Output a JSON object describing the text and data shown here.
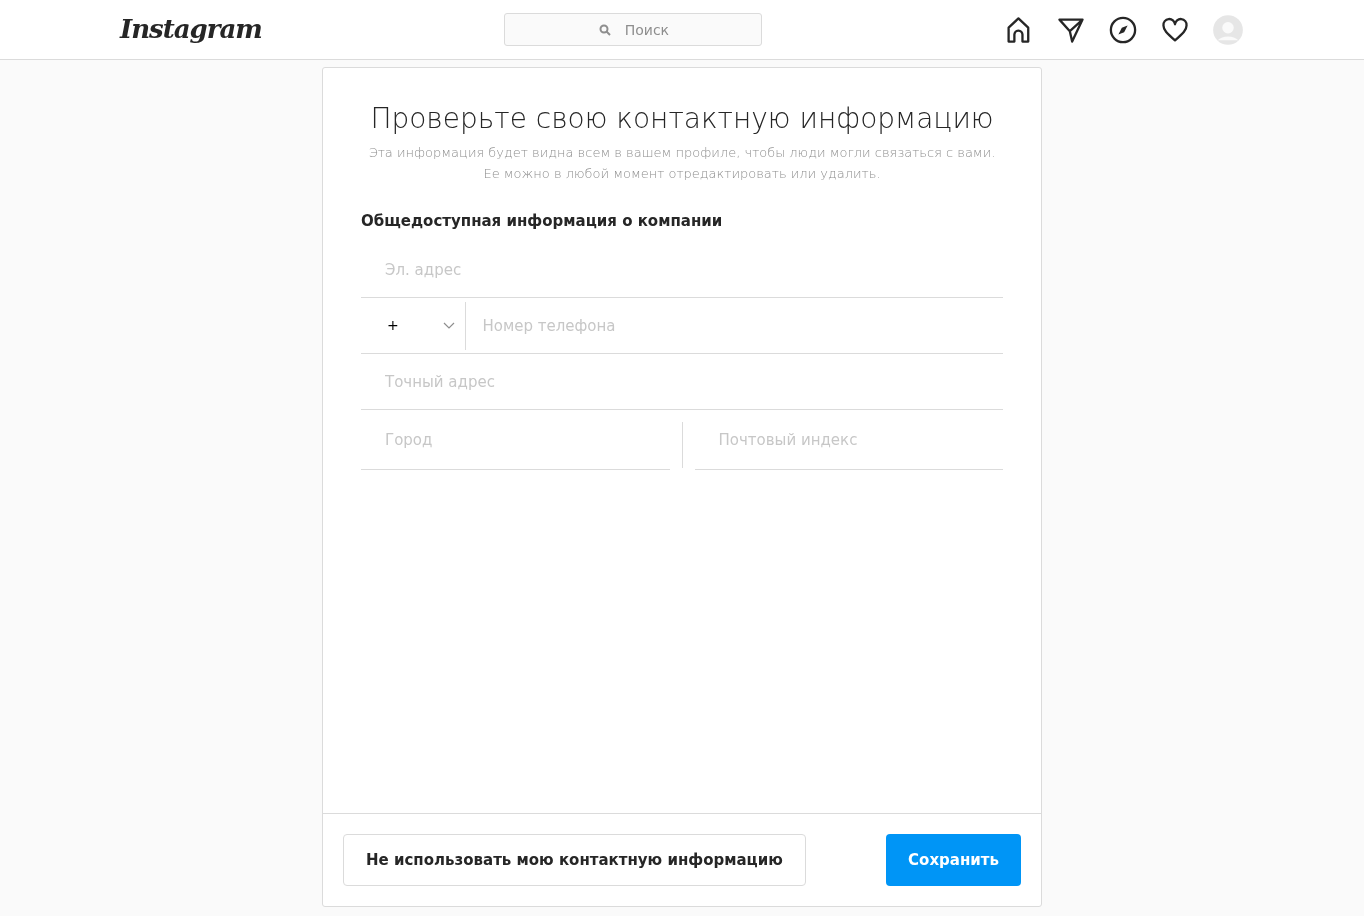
{
  "header": {
    "logo": "Instagram",
    "search": {
      "placeholder": "Поиск"
    }
  },
  "card": {
    "title": "Проверьте свою контактную информацию",
    "subtitle": "Эта информация будет видна всем в вашем профиле, чтобы люди могли связаться с вами. Ее можно в любой момент отредактировать или удалить.",
    "section": "Общедоступная информация о компании",
    "rows": [
      {
        "kind": "text",
        "fields": [
          {
            "placeholder": "Эл. адрес"
          }
        ]
      },
      {
        "kind": "phone",
        "prefix": "+",
        "fields": [
          {
            "placeholder": "Номер телефона"
          }
        ]
      },
      {
        "kind": "text",
        "fields": [
          {
            "placeholder": "Точный адрес"
          }
        ]
      },
      {
        "kind": "split",
        "fields": [
          {
            "placeholder": "Город"
          },
          {
            "placeholder": "Почтовый индекс"
          }
        ]
      }
    ],
    "buttons": [
      {
        "label": "Не использовать мою контактную информацию",
        "kind": "secondary"
      },
      {
        "label": "Сохранить",
        "kind": "primary"
      }
    ]
  }
}
